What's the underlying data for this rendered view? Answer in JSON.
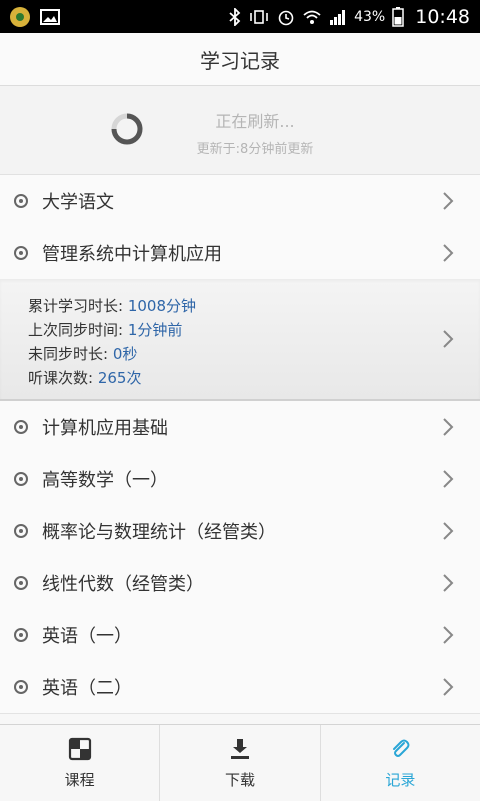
{
  "status_bar": {
    "battery": "43%",
    "time": "10:48"
  },
  "header": {
    "title": "学习记录"
  },
  "refresh": {
    "title": "正在刷新...",
    "subtitle": "更新于:8分钟前更新"
  },
  "courses": [
    {
      "label": "大学语文"
    },
    {
      "label": "管理系统中计算机应用"
    },
    {
      "label": "计算机应用基础"
    },
    {
      "label": "高等数学（一）"
    },
    {
      "label": "概率论与数理统计（经管类）"
    },
    {
      "label": "线性代数（经管类）"
    },
    {
      "label": "英语（一）"
    },
    {
      "label": "英语（二）"
    }
  ],
  "expanded_details": {
    "total_study_label": "累计学习时长: ",
    "total_study_value": "1008分钟",
    "last_sync_label": "上次同步时间: ",
    "last_sync_value": "1分钟前",
    "unsynced_label": "未同步时长: ",
    "unsynced_value": "0秒",
    "lessons_label": "听课次数: ",
    "lessons_value": "265次"
  },
  "tabs": [
    {
      "label": "课程",
      "icon": "course-grid-icon"
    },
    {
      "label": "下载",
      "icon": "download-icon"
    },
    {
      "label": "记录",
      "icon": "paperclip-icon"
    }
  ],
  "colors": {
    "accent": "#2aa6d6",
    "value_blue": "#2f66a8"
  }
}
